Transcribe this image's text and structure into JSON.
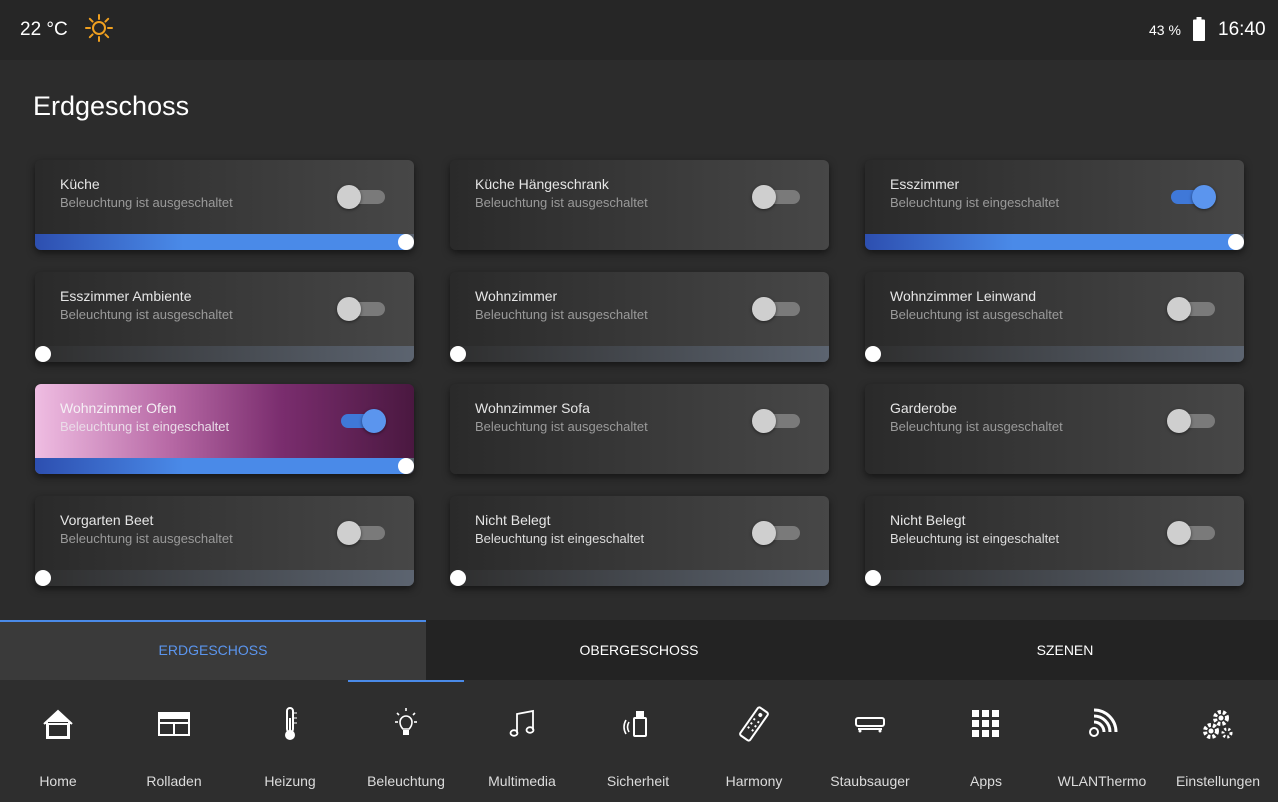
{
  "status_bar": {
    "temperature": "22 °C",
    "battery": "43 %",
    "time": "16:40"
  },
  "page": {
    "title": "Erdgeschoss"
  },
  "cards": [
    {
      "title": "Küche",
      "status": "Beleuchtung ist ausgeschaltet",
      "on": false,
      "level": 1.0,
      "slider": true
    },
    {
      "title": "Küche Hängeschrank",
      "status": "Beleuchtung ist ausgeschaltet",
      "on": false,
      "slider": false
    },
    {
      "title": "Esszimmer",
      "status": "Beleuchtung ist eingeschaltet",
      "on": true,
      "level": 1.0,
      "slider": true
    },
    {
      "title": "Esszimmer Ambiente",
      "status": "Beleuchtung ist ausgeschaltet",
      "on": false,
      "level": 0,
      "slider": true
    },
    {
      "title": "Wohnzimmer",
      "status": "Beleuchtung ist ausgeschaltet",
      "on": false,
      "level": 0,
      "slider": true
    },
    {
      "title": "Wohnzimmer Leinwand",
      "status": "Beleuchtung ist ausgeschaltet",
      "on": false,
      "level": 0,
      "slider": true
    },
    {
      "title": "Wohnzimmer Ofen",
      "status": "Beleuchtung ist eingeschaltet",
      "on": true,
      "level": 1.0,
      "slider": true,
      "highlight": true
    },
    {
      "title": "Wohnzimmer Sofa",
      "status": "Beleuchtung ist ausgeschaltet",
      "on": false,
      "slider": false
    },
    {
      "title": "Garderobe",
      "status": "Beleuchtung ist ausgeschaltet",
      "on": false,
      "slider": false
    },
    {
      "title": "Vorgarten Beet",
      "status": "Beleuchtung ist ausgeschaltet",
      "on": false,
      "level": 0,
      "slider": true
    },
    {
      "title": "Nicht Belegt",
      "status": "Beleuchtung ist eingeschaltet",
      "on": false,
      "level": 0,
      "slider": true,
      "garbled": true
    },
    {
      "title": "Nicht Belegt",
      "status": "Beleuchtung ist eingeschaltet",
      "on": false,
      "level": 0,
      "slider": true,
      "garbled": true
    }
  ],
  "tabs": [
    {
      "label": "ERDGESCHOSS",
      "active": true
    },
    {
      "label": "OBERGESCHOSS",
      "active": false
    },
    {
      "label": "SZENEN",
      "active": false
    }
  ],
  "nav": [
    {
      "label": "Home",
      "icon": "home-icon"
    },
    {
      "label": "Rolladen",
      "icon": "shutter-icon"
    },
    {
      "label": "Heizung",
      "icon": "thermometer-icon"
    },
    {
      "label": "Beleuchtung",
      "icon": "bulb-icon",
      "active": true
    },
    {
      "label": "Multimedia",
      "icon": "music-note-icon"
    },
    {
      "label": "Sicherheit",
      "icon": "alarm-icon"
    },
    {
      "label": "Harmony",
      "icon": "remote-icon"
    },
    {
      "label": "Staubsauger",
      "icon": "vacuum-icon"
    },
    {
      "label": "Apps",
      "icon": "apps-grid-icon"
    },
    {
      "label": "WLANThermo",
      "icon": "wlan-thermo-icon"
    },
    {
      "label": "Einstellungen",
      "icon": "gears-icon"
    }
  ],
  "colors": {
    "accent": "#4a8ae8",
    "highlight_card": "#b86aa6",
    "sun": "#f0a020"
  }
}
